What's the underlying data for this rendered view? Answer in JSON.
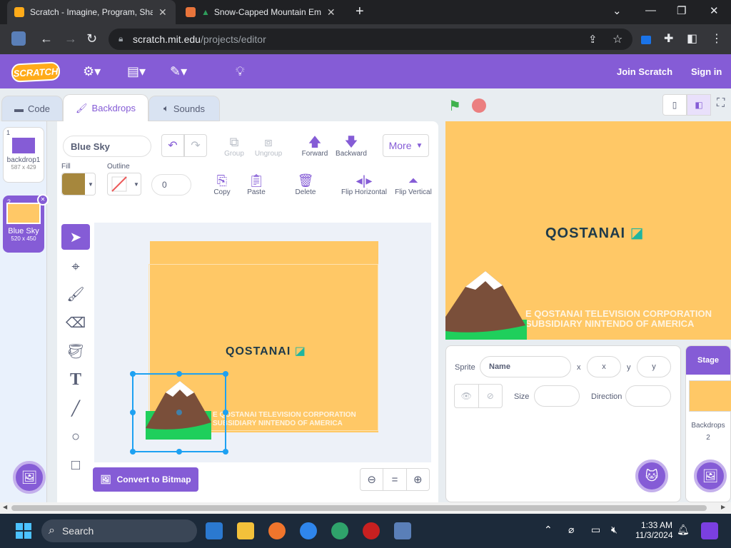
{
  "browser": {
    "tabs": [
      {
        "title": "Scratch - Imagine, Program, Sha",
        "active": true
      },
      {
        "title": "Snow-Capped Mountain Em",
        "active": false
      }
    ],
    "url_host": "scratch.mit.edu",
    "url_path": "/projects/editor"
  },
  "header": {
    "logo": "SCRATCH",
    "join": "Join Scratch",
    "signin": "Sign in"
  },
  "editor_tabs": {
    "code": "Code",
    "backdrops": "Backdrops",
    "sounds": "Sounds"
  },
  "backdrops": [
    {
      "num": "1",
      "name": "backdrop1",
      "size": "587 x 429"
    },
    {
      "num": "2",
      "name": "Blue Sky",
      "size": "520 x 450"
    }
  ],
  "paint": {
    "name": "Blue Sky",
    "group": "Group",
    "ungroup": "Ungroup",
    "forward": "Forward",
    "backward": "Backward",
    "more": "More",
    "fill_label": "Fill",
    "outline_label": "Outline",
    "outline_width": "0",
    "copy": "Copy",
    "paste": "Paste",
    "delete": "Delete",
    "flip_h": "Flip Horizontal",
    "flip_v": "Flip Vertical",
    "convert": "Convert to Bitmap",
    "zoom_reset": "=",
    "fill_color": "#a6873d"
  },
  "artwork": {
    "brand": "QOSTANAI",
    "line1": "E QOSTANAI TELEVISION CORPORATION",
    "line2": "SUBSIDIARY NINTENDO OF AMERICA"
  },
  "sprite": {
    "label": "Sprite",
    "name_placeholder": "Name",
    "x_label": "x",
    "x_placeholder": "x",
    "y_label": "y",
    "y_placeholder": "y",
    "size_label": "Size",
    "direction_label": "Direction"
  },
  "stage_panel": {
    "title": "Stage",
    "backdrops_label": "Backdrops",
    "count": "2"
  },
  "taskbar": {
    "search": "Search",
    "time": "1:33 AM",
    "date": "11/3/2024"
  },
  "colors": {
    "accent": "#855cd6",
    "stage_bg": "#ffc866",
    "mountain": "#7a4f3a",
    "grass": "#1fcf5c"
  }
}
